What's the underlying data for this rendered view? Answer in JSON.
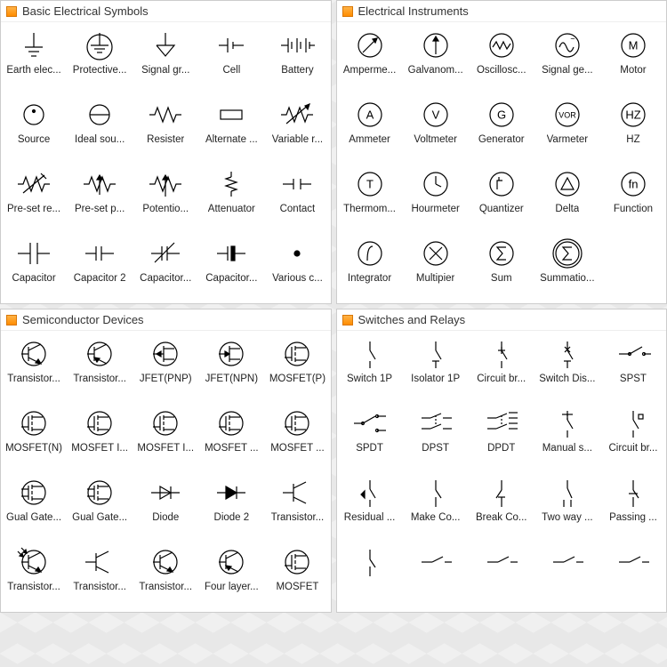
{
  "panels": [
    {
      "title": "Basic Electrical Symbols",
      "items": [
        {
          "label": "Earth elec...",
          "icon": "earth"
        },
        {
          "label": "Protective...",
          "icon": "protective-earth"
        },
        {
          "label": "Signal gr...",
          "icon": "signal-ground"
        },
        {
          "label": "Cell",
          "icon": "cell"
        },
        {
          "label": "Battery",
          "icon": "battery"
        },
        {
          "label": "Source",
          "icon": "source"
        },
        {
          "label": "Ideal sou...",
          "icon": "ideal-source"
        },
        {
          "label": "Resister",
          "icon": "resistor"
        },
        {
          "label": "Alternate ...",
          "icon": "alternate-resistor"
        },
        {
          "label": "Variable r...",
          "icon": "variable-resistor"
        },
        {
          "label": "Pre-set re...",
          "icon": "preset-resistor"
        },
        {
          "label": "Pre-set p...",
          "icon": "preset-p"
        },
        {
          "label": "Potentio...",
          "icon": "potentiometer"
        },
        {
          "label": "Attenuator",
          "icon": "attenuator"
        },
        {
          "label": "Contact",
          "icon": "contact"
        },
        {
          "label": "Capacitor",
          "icon": "capacitor"
        },
        {
          "label": "Capacitor 2",
          "icon": "capacitor2"
        },
        {
          "label": "Capacitor...",
          "icon": "capacitor3"
        },
        {
          "label": "Capacitor...",
          "icon": "capacitor4"
        },
        {
          "label": "Various c...",
          "icon": "dot"
        }
      ]
    },
    {
      "title": "Electrical Instruments",
      "items": [
        {
          "label": "Amperme...",
          "icon": "ampermeter"
        },
        {
          "label": "Galvanom...",
          "icon": "galvanometer"
        },
        {
          "label": "Oscillosc...",
          "icon": "oscilloscope"
        },
        {
          "label": "Signal ge...",
          "icon": "signal-gen"
        },
        {
          "label": "Motor",
          "icon": "motor",
          "txt": "M"
        },
        {
          "label": "Ammeter",
          "icon": "circ",
          "txt": "A"
        },
        {
          "label": "Voltmeter",
          "icon": "circ",
          "txt": "V"
        },
        {
          "label": "Generator",
          "icon": "circ",
          "txt": "G"
        },
        {
          "label": "Varmeter",
          "icon": "circ-sm",
          "txt": "VOR"
        },
        {
          "label": "HZ",
          "icon": "circ",
          "txt": "HZ"
        },
        {
          "label": "Thermom...",
          "icon": "circ",
          "txt": "T"
        },
        {
          "label": "Hourmeter",
          "icon": "hourmeter"
        },
        {
          "label": "Quantizer",
          "icon": "quantizer"
        },
        {
          "label": "Delta",
          "icon": "delta"
        },
        {
          "label": "Function",
          "icon": "circ",
          "txt": "fn"
        },
        {
          "label": "Integrator",
          "icon": "integrator"
        },
        {
          "label": "Multipier",
          "icon": "multiplier"
        },
        {
          "label": "Sum",
          "icon": "sum"
        },
        {
          "label": "Summatio...",
          "icon": "summation"
        }
      ]
    },
    {
      "title": "Semiconductor Devices",
      "items": [
        {
          "label": "Transistor...",
          "icon": "npn"
        },
        {
          "label": "Transistor...",
          "icon": "pnp"
        },
        {
          "label": "JFET(PNP)",
          "icon": "jfet-pnp"
        },
        {
          "label": "JFET(NPN)",
          "icon": "jfet-npn"
        },
        {
          "label": "MOSFET(P)",
          "icon": "mosfet-p"
        },
        {
          "label": "MOSFET(N)",
          "icon": "mosfet-n"
        },
        {
          "label": "MOSFET I...",
          "icon": "mosfet-i1"
        },
        {
          "label": "MOSFET I...",
          "icon": "mosfet-i2"
        },
        {
          "label": "MOSFET ...",
          "icon": "mosfet-g1"
        },
        {
          "label": "MOSFET ...",
          "icon": "mosfet-g2"
        },
        {
          "label": "Gual Gate...",
          "icon": "dual-gate1"
        },
        {
          "label": "Gual Gate...",
          "icon": "dual-gate2"
        },
        {
          "label": "Diode",
          "icon": "diode"
        },
        {
          "label": "Diode 2",
          "icon": "diode2"
        },
        {
          "label": "Transistor...",
          "icon": "trans-simple"
        },
        {
          "label": "Transistor...",
          "icon": "photo-trans"
        },
        {
          "label": "Transistor...",
          "icon": "trans-b1"
        },
        {
          "label": "Transistor...",
          "icon": "trans-b2"
        },
        {
          "label": "Four layer...",
          "icon": "four-layer"
        },
        {
          "label": "MOSFET",
          "icon": "mosfet"
        }
      ]
    },
    {
      "title": "Switches and Relays",
      "items": [
        {
          "label": "Switch 1P",
          "icon": "switch1p"
        },
        {
          "label": "Isolator 1P",
          "icon": "isolator1p"
        },
        {
          "label": "Circuit br...",
          "icon": "cb1"
        },
        {
          "label": "Switch Dis...",
          "icon": "switch-dis"
        },
        {
          "label": "SPST",
          "icon": "spst"
        },
        {
          "label": "SPDT",
          "icon": "spdt"
        },
        {
          "label": "DPST",
          "icon": "dpst"
        },
        {
          "label": "DPDT",
          "icon": "dpdt"
        },
        {
          "label": "Manual s...",
          "icon": "manual"
        },
        {
          "label": "Circuit br...",
          "icon": "cb2"
        },
        {
          "label": "Residual ...",
          "icon": "residual"
        },
        {
          "label": "Make Co...",
          "icon": "make"
        },
        {
          "label": "Break Co...",
          "icon": "break"
        },
        {
          "label": "Two way ...",
          "icon": "twoway"
        },
        {
          "label": "Passing ...",
          "icon": "passing"
        },
        {
          "label": "",
          "icon": "sw-extra1"
        },
        {
          "label": "",
          "icon": "sw-extra2"
        },
        {
          "label": "",
          "icon": "sw-extra3"
        },
        {
          "label": "",
          "icon": "sw-extra4"
        },
        {
          "label": "",
          "icon": "sw-extra5"
        }
      ]
    }
  ]
}
